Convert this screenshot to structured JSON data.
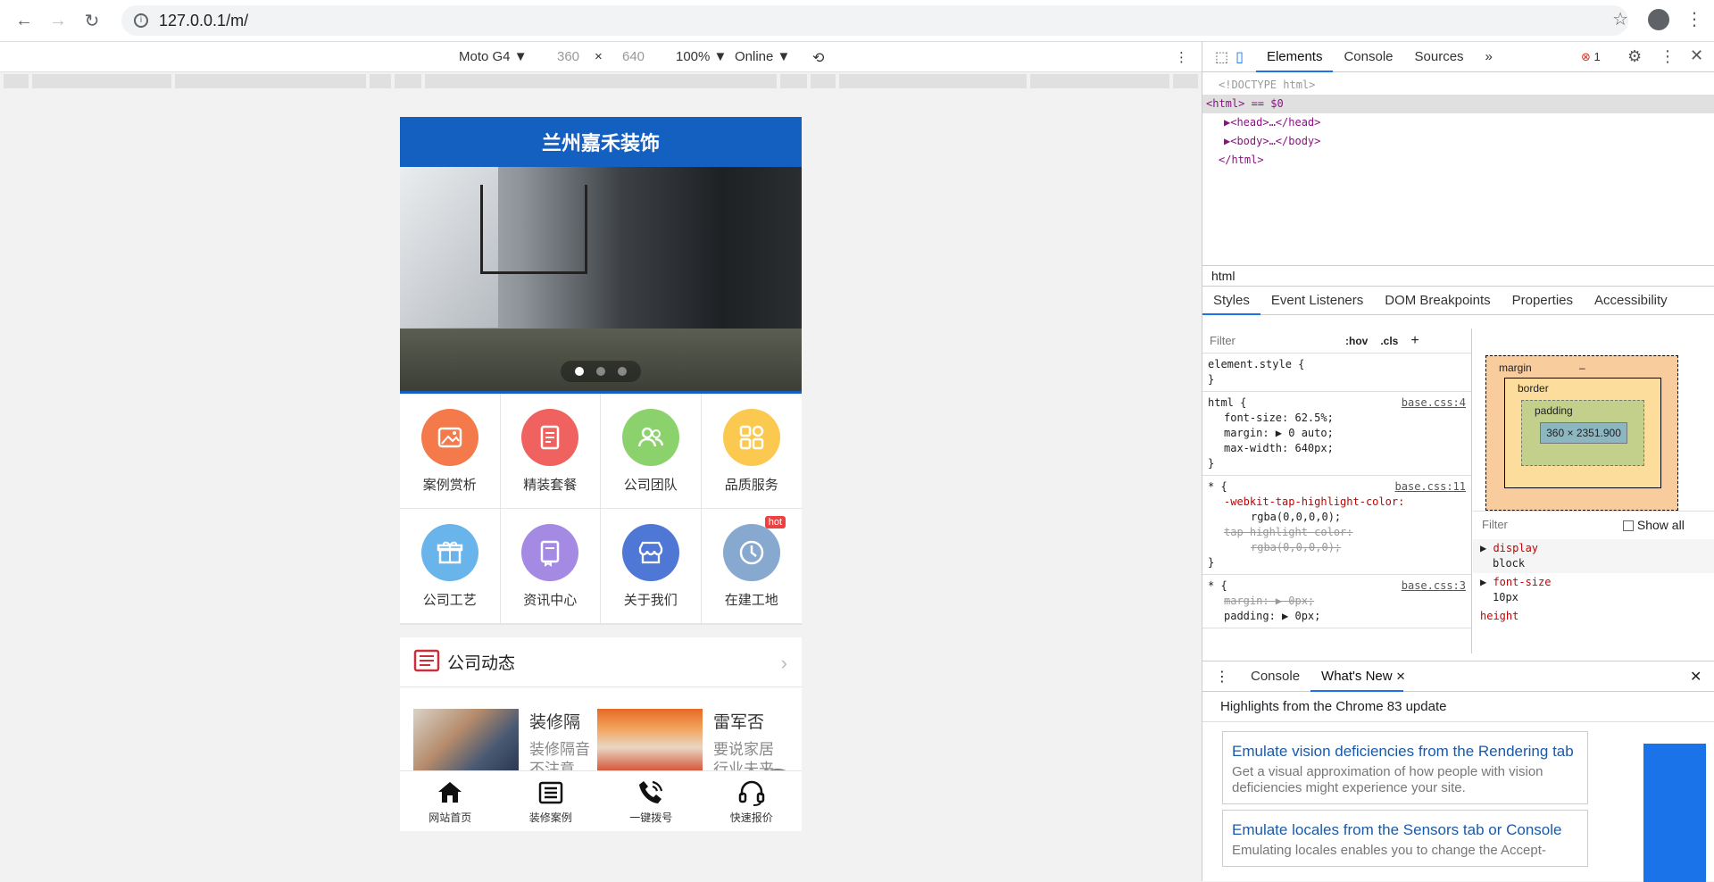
{
  "browser": {
    "url": "127.0.0.1/m/"
  },
  "device_toolbar": {
    "device": "Moto G4 ▼",
    "width": "360",
    "times": "×",
    "height": "640",
    "zoom": "100% ▼",
    "throttle": "Online ▼"
  },
  "site": {
    "title": "兰州嘉禾装饰",
    "grid": [
      {
        "label": "案例赏析",
        "color": "#f47a4b",
        "icon": "image-icon"
      },
      {
        "label": "精装套餐",
        "color": "#f0625f",
        "icon": "document-icon"
      },
      {
        "label": "公司团队",
        "color": "#8bd26c",
        "icon": "team-icon"
      },
      {
        "label": "品质服务",
        "color": "#fbc94f",
        "icon": "apps-icon"
      },
      {
        "label": "公司工艺",
        "color": "#69b5eb",
        "icon": "gift-icon"
      },
      {
        "label": "资讯中心",
        "color": "#a58ae3",
        "icon": "book-icon"
      },
      {
        "label": "关于我们",
        "color": "#4f78d6",
        "icon": "store-icon"
      },
      {
        "label": "在建工地",
        "color": "#87a8cf",
        "icon": "clock-icon",
        "badge": "hot"
      }
    ],
    "news_section": "公司动态",
    "news": [
      {
        "title": "装修隔",
        "summary": "装修隔音不注意"
      },
      {
        "title": "雷军否",
        "summary": "要说家居行业未来"
      }
    ],
    "tabbar": [
      {
        "label": "网站首页",
        "icon": "home-icon"
      },
      {
        "label": "装修案例",
        "icon": "news-icon"
      },
      {
        "label": "一键拨号",
        "icon": "phone-icon"
      },
      {
        "label": "快速报价",
        "icon": "headset-icon"
      }
    ]
  },
  "devtools": {
    "tabs": [
      "Elements",
      "Console",
      "Sources",
      "»"
    ],
    "error_count": "1",
    "dom": [
      "<!DOCTYPE html>",
      "<html> == $0",
      "▶<head>…</head>",
      "▶<body>…</body>",
      "</html>"
    ],
    "breadcrumb": "html",
    "sub_tabs": [
      "Styles",
      "Event Listeners",
      "DOM Breakpoints",
      "Properties",
      "Accessibility"
    ],
    "filter_placeholder": "Filter",
    "hov": ":hov",
    "cls": ".cls",
    "element_style": "element.style {",
    "rule1_selector": "html {",
    "rule1_source": "base.css:4",
    "rule1_props": [
      "font-size: 62.5%;",
      "margin: ▶ 0 auto;",
      "max-width: 640px;"
    ],
    "rule2_selector": "* {",
    "rule2_source": "base.css:11",
    "rule2_props": [
      "-webkit-tap-highlight-color:",
      "rgba(0,0,0,0);",
      "tap-highlight-color:",
      "rgba(0,0,0,0);"
    ],
    "rule3_selector": "* {",
    "rule3_source": "base.css:3",
    "rule3_props": [
      "margin: ▶ 0px;",
      "padding: ▶ 0px;"
    ],
    "box_model": {
      "margin": "margin",
      "border": "border",
      "padding": "padding",
      "content": "360 × 2351.900",
      "dash": "–"
    },
    "computed_filter": "Filter",
    "show_all": "Show all",
    "computed": [
      {
        "name": "display",
        "value": "block"
      },
      {
        "name": "font-size",
        "value": "10px"
      },
      {
        "name": "height",
        "value": ""
      }
    ],
    "drawer_tabs": [
      "Console",
      "What's New"
    ],
    "whats_new_title": "Highlights from the Chrome 83 update",
    "cards": [
      {
        "title": "Emulate vision deficiencies from the Rendering tab",
        "desc": "Get a visual approximation of how people with vision deficiencies might experience your site."
      },
      {
        "title": "Emulate locales from the Sensors tab or Console",
        "desc": "Emulating locales enables you to change the Accept-"
      }
    ]
  }
}
